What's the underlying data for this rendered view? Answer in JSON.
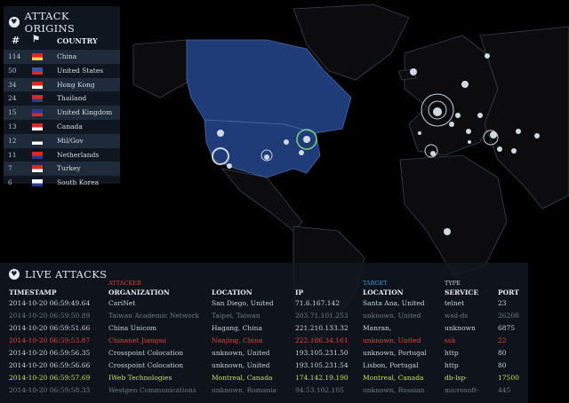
{
  "origins": {
    "title": "ATTACK ORIGINS",
    "title_icon": "heart-icon",
    "header": {
      "hash": "#",
      "flag_icon": "flag-icon",
      "country": "COUNTRY"
    },
    "rows": [
      {
        "count": "114",
        "country": "China",
        "flag": "cn"
      },
      {
        "count": "50",
        "country": "United States",
        "flag": "us"
      },
      {
        "count": "34",
        "country": "Hong Kong",
        "flag": "hk"
      },
      {
        "count": "24",
        "country": "Thailand",
        "flag": "th"
      },
      {
        "count": "15",
        "country": "United Kingdom",
        "flag": "gb"
      },
      {
        "count": "13",
        "country": "Canada",
        "flag": "ca"
      },
      {
        "count": "12",
        "country": "Mil/Gov",
        "flag": "mil"
      },
      {
        "count": "11",
        "country": "Netherlands",
        "flag": "nl"
      },
      {
        "count": "7",
        "country": "Turkey",
        "flag": "tr"
      },
      {
        "count": "6",
        "country": "South Korea",
        "flag": "kr"
      }
    ]
  },
  "live": {
    "title": "LIVE ATTACKS",
    "groups": {
      "attacker": "ATTACKER",
      "target": "TARGET",
      "type": "TYPE"
    },
    "columns": {
      "timestamp": "TIMESTAMP",
      "organization": "ORGANIZATION",
      "location": "LOCATION",
      "ip": "IP",
      "tlocation": "LOCATION",
      "service": "SERVICE",
      "port": "PORT"
    },
    "rows": [
      {
        "ts": "2014-10-20 06:59:49.64",
        "org": "CariNet",
        "loc": "San Diego, United",
        "ip": "71.6.167.142",
        "tloc": "Santa Ana, United",
        "svc": "telnet",
        "port": "23",
        "color": "#c9d2da"
      },
      {
        "ts": "2014-10-20 06:59:50.89",
        "org": "Taiwan Academic Network",
        "loc": "Taipei, Taiwan",
        "ip": "203.71.101.253",
        "tloc": "unknown, United",
        "svc": "wsd-ds",
        "port": "26208",
        "color": "#6f7a84"
      },
      {
        "ts": "2014-10-20 06:59:51.66",
        "org": "China Unicom",
        "loc": "Hagang, China",
        "ip": "221.210.133.32",
        "tloc": "Manran,",
        "svc": "unknown",
        "port": "6875",
        "color": "#c9d2da"
      },
      {
        "ts": "2014-10-20 06:59:53.87",
        "org": "Chinanet Jiangsu",
        "loc": "Nanjing, China",
        "ip": "222.186.34.161",
        "tloc": "unknown, United",
        "svc": "ssh",
        "port": "22",
        "color": "#e0453c"
      },
      {
        "ts": "2014-10-20 06:59:56.35",
        "org": "Crosspoint Colocation",
        "loc": "unknown, United",
        "ip": "193.105.231.50",
        "tloc": "unknown, Portugal",
        "svc": "http",
        "port": "80",
        "color": "#c9d2da"
      },
      {
        "ts": "2014-10-20 06:59:56.66",
        "org": "Crosspoint Colocation",
        "loc": "unknown, United",
        "ip": "193.105.231.54",
        "tloc": "Lisbon, Portugal",
        "svc": "http",
        "port": "80",
        "color": "#c9d2da"
      },
      {
        "ts": "2014-10-20 06:59:57.69",
        "org": "IWeb Technologies",
        "loc": "Montreal, Canada",
        "ip": "174.142.19.190",
        "tloc": "Montreal, Canada",
        "svc": "db-lsp-",
        "port": "17500",
        "color": "#c4e05a"
      },
      {
        "ts": "2014-10-20 06:59:58.33",
        "org": "Westgen Communications",
        "loc": "unknown, Romania",
        "ip": "94.53.102.105",
        "tloc": "unknown, Russian",
        "svc": "microsoft-",
        "port": "445",
        "color": "#6f7a84"
      }
    ]
  },
  "map": {
    "ocean": "#000000",
    "land": "#0c0c0f",
    "highlight_land": "#1f3c78",
    "border": "#3b4150"
  }
}
